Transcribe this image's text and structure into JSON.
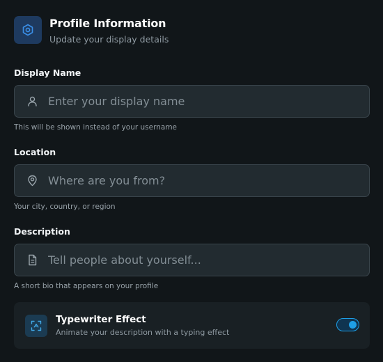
{
  "header": {
    "icon": "hexagon-settings-icon",
    "title": "Profile Information",
    "subtitle": "Update your display details"
  },
  "fields": [
    {
      "label": "Display Name",
      "icon": "user-icon",
      "value": "",
      "placeholder": "Enter your display name",
      "hint": "This will be shown instead of your username"
    },
    {
      "label": "Location",
      "icon": "map-pin-icon",
      "value": "",
      "placeholder": "Where are you from?",
      "hint": "Your city, country, or region"
    },
    {
      "label": "Description",
      "icon": "document-icon",
      "value": "",
      "placeholder": "Tell people about yourself...",
      "hint": "A short bio that appears on your profile"
    }
  ],
  "typewriter": {
    "icon": "scan-text-icon",
    "title": "Typewriter Effect",
    "subtitle": "Animate your description with a typing effect",
    "enabled": true
  },
  "colors": {
    "background": "#111619",
    "input_background": "#222b30",
    "accent": "#1e9fe6",
    "header_icon_bg": "#1e3a5f"
  }
}
